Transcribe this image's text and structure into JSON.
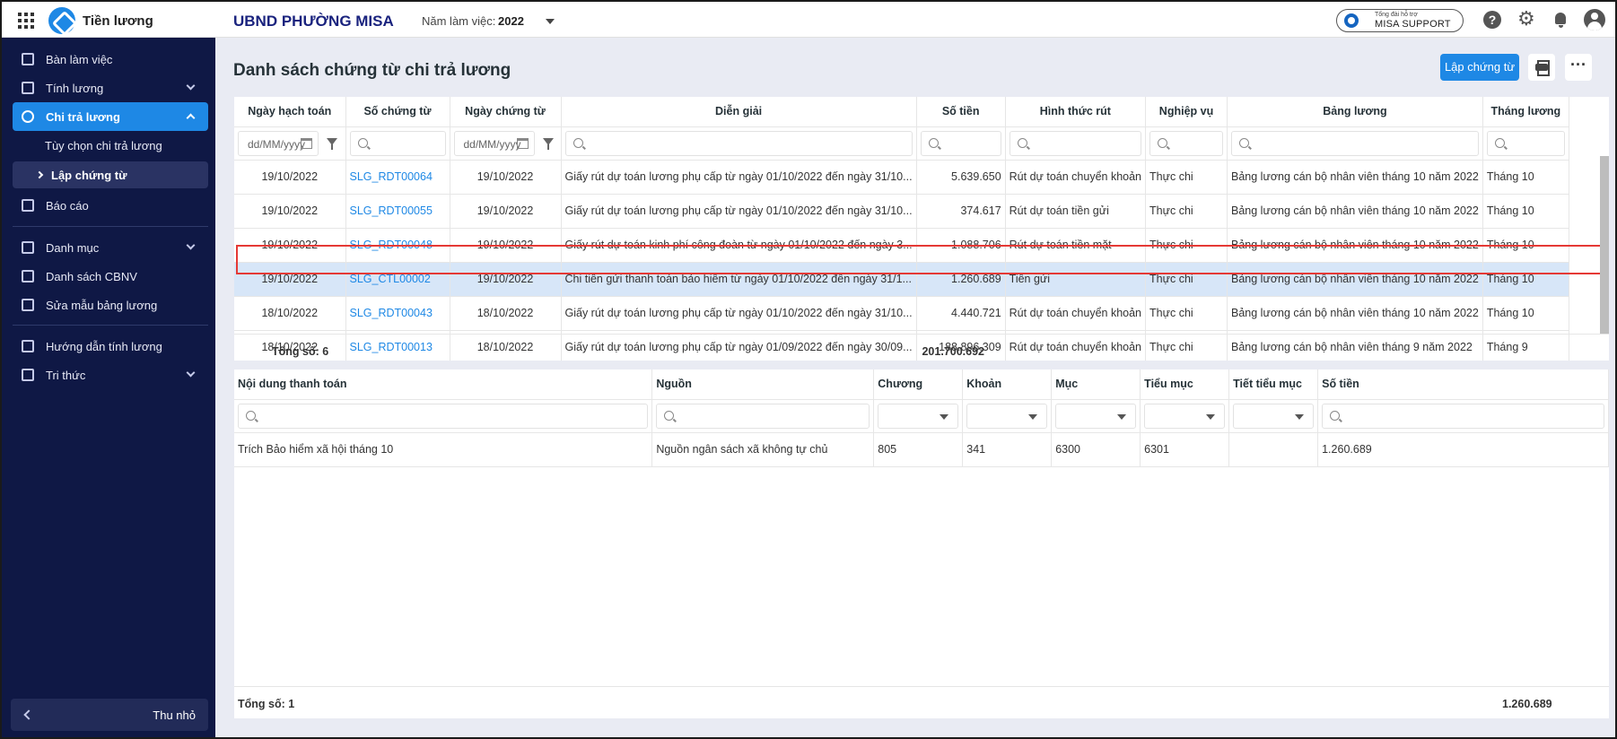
{
  "app": {
    "name": "Tiền lương",
    "org": "UBND PHƯỜNG MISA",
    "year_label": "Năm làm việc:",
    "year_value": "2022"
  },
  "support": {
    "small": "Tổng đài hỗ trợ",
    "main": "MISA SUPPORT"
  },
  "sidebar": {
    "items": [
      {
        "label": "Bàn làm việc"
      },
      {
        "label": "Tính lương"
      },
      {
        "label": "Chi trả lương"
      },
      {
        "label": "Tùy chọn chi trả lương"
      },
      {
        "label": "Lập chứng từ"
      },
      {
        "label": "Báo cáo"
      },
      {
        "label": "Danh mục"
      },
      {
        "label": "Danh sách CBNV"
      },
      {
        "label": "Sửa mẫu bảng lương"
      },
      {
        "label": "Hướng dẫn tính lương"
      },
      {
        "label": "Tri thức"
      }
    ],
    "collapse_label": "Thu nhỏ"
  },
  "page": {
    "title": "Danh sách chứng từ chi trả lương",
    "create_button": "Lập chứng từ",
    "more": "···"
  },
  "vouchers": {
    "columns": [
      "Ngày hạch toán",
      "Số chứng từ",
      "Ngày chứng từ",
      "Diễn giải",
      "Số tiền",
      "Hình thức rút",
      "Nghiệp vụ",
      "Bảng lương",
      "Tháng lương"
    ],
    "date_placeholder": "dd/MM/yyyy",
    "rows": [
      [
        "19/10/2022",
        "SLG_RDT00064",
        "19/10/2022",
        "Giấy rút dự toán lương phụ cấp từ ngày 01/10/2022 đến ngày 31/10...",
        "5.639.650",
        "Rút dự toán chuyển khoản",
        "Thực chi",
        "Bảng lương cán bộ nhân viên tháng 10 năm 2022",
        "Tháng 10"
      ],
      [
        "19/10/2022",
        "SLG_RDT00055",
        "19/10/2022",
        "Giấy rút dự toán lương phụ cấp từ ngày 01/10/2022 đến ngày 31/10...",
        "374.617",
        "Rút dự toán tiền gửi",
        "Thực chi",
        "Bảng lương cán bộ nhân viên tháng 10 năm 2022",
        "Tháng 10"
      ],
      [
        "19/10/2022",
        "SLG_RDT00048",
        "19/10/2022",
        "Giấy rút dự toán kinh phí công đoàn từ ngày 01/10/2022 đến ngày 3...",
        "1.088.706",
        "Rút dự toán tiền mặt",
        "Thực chi",
        "Bảng lương cán bộ nhân viên tháng 10 năm 2022",
        "Tháng 10"
      ],
      [
        "19/10/2022",
        "SLG_CTL00002",
        "19/10/2022",
        "Chi tiền gửi thanh toán bảo hiểm từ ngày 01/10/2022 đến ngày 31/1...",
        "1.260.689",
        "Tiền gửi",
        "Thực chi",
        "Bảng lương cán bộ nhân viên tháng 10 năm 2022",
        "Tháng 10"
      ],
      [
        "18/10/2022",
        "SLG_RDT00043",
        "18/10/2022",
        "Giấy rút dự toán lương phụ cấp từ ngày 01/10/2022 đến ngày 31/10...",
        "4.440.721",
        "Rút dự toán chuyển khoản",
        "Thực chi",
        "Bảng lương cán bộ nhân viên tháng 10 năm 2022",
        "Tháng 10"
      ],
      [
        "18/10/2022",
        "SLG_RDT00013",
        "18/10/2022",
        "Giấy rút dự toán lương phụ cấp từ ngày 01/09/2022 đến ngày 30/09...",
        "188.896.309",
        "Rút dự toán chuyển khoản",
        "Thực chi",
        "Bảng lương cán bộ nhân viên tháng 9 năm 2022",
        "Tháng 9"
      ]
    ],
    "total_label": "Tổng số: 6",
    "total_amount": "201.700.692"
  },
  "details": {
    "columns": [
      "Nội dung thanh toán",
      "Nguồn",
      "Chương",
      "Khoản",
      "Mục",
      "Tiểu mục",
      "Tiết tiểu mục",
      "Số tiền"
    ],
    "rows": [
      [
        "Trích Bảo hiểm xã hội tháng 10",
        "Nguồn ngân sách xã không tự chủ",
        "805",
        "341",
        "6300",
        "6301",
        "",
        "1.260.689"
      ]
    ],
    "total_label": "Tổng số: 1",
    "total_amount": "1.260.689"
  }
}
